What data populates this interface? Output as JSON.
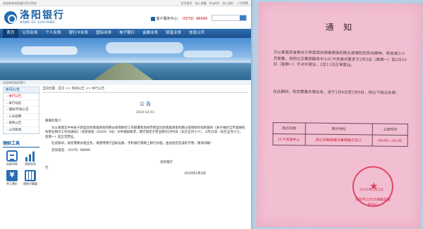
{
  "site": {
    "topbar_left": "欢迎来到洛阳银行官方网站",
    "topbar_links": [
      "设为首页",
      "加入收藏",
      "English",
      "网上银行",
      "人才招聘"
    ],
    "logo_cn": "洛阳银行",
    "logo_en": "BANK OF LUOYANG",
    "hotline_label": "客户服务中心:",
    "hotline_number": "（0379）96699",
    "nav": [
      "首页",
      "公司业务",
      "个人业务",
      "银行卡业务",
      "国际业务",
      "电子银行",
      "金融业务",
      "财富业务",
      "信息公开"
    ],
    "crumb_bar": "欢迎来到洛阳银行",
    "sidebar_title": "新闻公告",
    "sidebar_items": [
      "本行公告",
      "本行动态",
      "理财/存款公告",
      "人员招聘",
      "采购公告",
      "公司新闻"
    ],
    "tools_title": "理财工具",
    "tools": [
      {
        "label": "存款利率",
        "icon": "deposit-icon"
      },
      {
        "label": "贷款利率",
        "icon": "loan-chart-icon"
      },
      {
        "label": "外汇牌价",
        "icon": "yen-icon"
      },
      {
        "label": "理财计算器",
        "icon": "calculator-icon"
      }
    ],
    "breadcrumb": "当前位置：首页 >> 新闻公告 >> 本行公告",
    "notice_title": "公 告",
    "notice_date": "2020-02-03",
    "greeting": "尊敬的客户:",
    "para1": "为认真落实中共关于新型冠状病毒感染的肺炎疫情防控工作部署和洛阳市新型冠状病毒感染的肺炎疫情防控指挥部的《关于做好全市金融机构营业网点工作的通知》（洛疫防指〔2020〕4号）文件通知要求，我行暂定于营业网点2月9日（农历正月十六）、2月10日（农历正月十七，星期一）起正常营业。",
    "para2": "在此期间，如您需要办理业务，请使用我行自助设备、手机银行或网上银行办理，由此给您造成的不便，敬请谅解！",
    "service_phone": "咨询电话：（0379）96699",
    "signature": "洛阳银行",
    "row_bank": "行",
    "sign_date": "2020年2月3日"
  },
  "paper": {
    "title": "通 知",
    "p1": "为认真落实省委关于新型冠状病毒感染的肺炎疫情防控有关精神，有效减少人员聚集，洛阳公交集团服务中心IC卡充值点暂定于2月3日（星期一）至2月10日（星期一）不对外营业，2月11日正常营业。",
    "p2": "在此期间，如您需要办理业务，请于2月4日至2月9日，到以下网点办理：",
    "table_headers": [
      "网点名称",
      "网点地址",
      "上班时间"
    ],
    "table_rows": [
      {
        "name": "IC卡充值中心",
        "address": "西工区解放路与春晓路交叉口",
        "hours": "09:00—16:00"
      }
    ],
    "stamp_text": "洛阳市公共交通集团服务中心",
    "date": "2020年2月3日"
  }
}
